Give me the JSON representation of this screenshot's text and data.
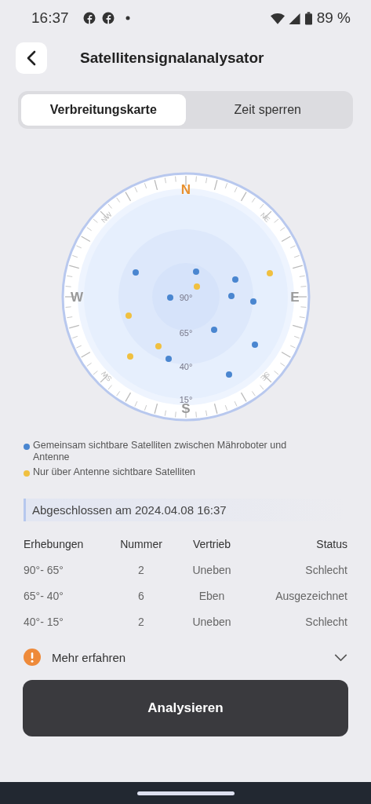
{
  "status_bar": {
    "time": "16:37",
    "battery": "89 %"
  },
  "header": {
    "title": "Satellitensignalanalysator"
  },
  "tabs": [
    {
      "label": "Verbreitungskarte",
      "selected": true
    },
    {
      "label": "Zeit sperren",
      "selected": false
    }
  ],
  "sky_plot": {
    "directions": [
      "N",
      "E",
      "S",
      "W"
    ],
    "intercardinals": [
      "NE",
      "SE",
      "SW",
      "NW"
    ],
    "rings": [
      "90°",
      "65°",
      "40°",
      "15°"
    ]
  },
  "legend": [
    {
      "label": "Gemeinsam sichtbare Satelliten zwischen Mähroboter und Antenne",
      "color": "#4a86d0"
    },
    {
      "label": "Nur über Antenne sichtbare Satelliten",
      "color": "#f0c040"
    }
  ],
  "result_banner": "Abgeschlossen am 2024.04.08 16:37",
  "table": {
    "columns": [
      "Erhebungen",
      "Nummer",
      "Vertrieb",
      "Status"
    ],
    "rows": [
      [
        "90°- 65°",
        "2",
        "Uneben",
        "Schlecht"
      ],
      [
        "65°- 40°",
        "6",
        "Eben",
        "Ausgezeichnet"
      ],
      [
        "40°- 15°",
        "2",
        "Uneben",
        "Schlecht"
      ]
    ]
  },
  "more_info": {
    "label": "Mehr erfahren",
    "expanded": false
  },
  "button": "Analysieren"
}
